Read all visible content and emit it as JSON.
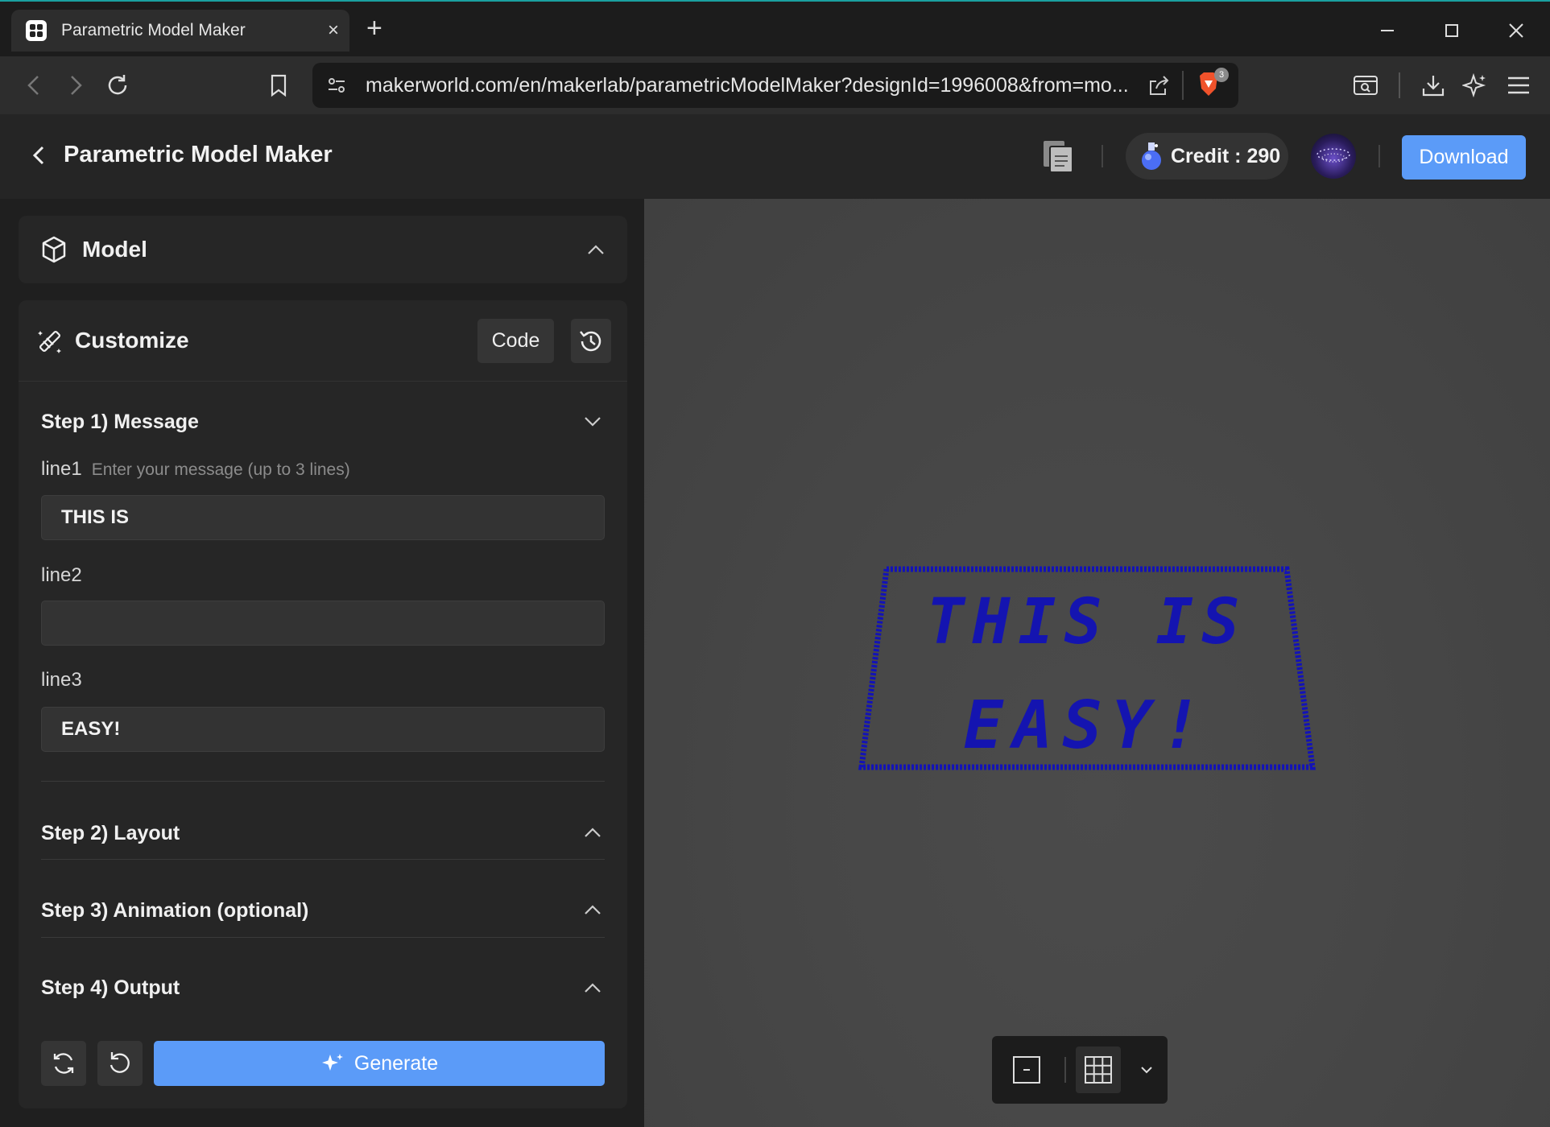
{
  "browser": {
    "tab_title": "Parametric Model Maker",
    "tab_close": "×",
    "new_tab": "+",
    "url": "makerworld.com/en/makerlab/parametricModelMaker?designId=1996008&from=mo...",
    "brave_badge_count": "3"
  },
  "header": {
    "title": "Parametric Model Maker",
    "credit_label": "Credit : 290",
    "download_label": "Download"
  },
  "model_panel": {
    "label": "Model"
  },
  "customize": {
    "label": "Customize",
    "code_label": "Code",
    "steps": [
      {
        "title": "Step 1) Message"
      },
      {
        "title": "Step 2) Layout"
      },
      {
        "title": "Step 3) Animation (optional)"
      },
      {
        "title": "Step 4) Output"
      }
    ],
    "fields": [
      {
        "label": "line1",
        "hint": "Enter your message (up to 3 lines)",
        "value": "THIS IS"
      },
      {
        "label": "line2",
        "hint": "",
        "value": ""
      },
      {
        "label": "line3",
        "hint": "",
        "value": "EASY!"
      }
    ],
    "generate_label": "Generate"
  },
  "viewport": {
    "preview_line1": "THIS IS",
    "preview_line2": "EASY!",
    "preview_color": "#1212b8"
  },
  "colors": {
    "accent": "#5b9bf8",
    "panel": "#262626",
    "background": "#1f1f1f"
  }
}
